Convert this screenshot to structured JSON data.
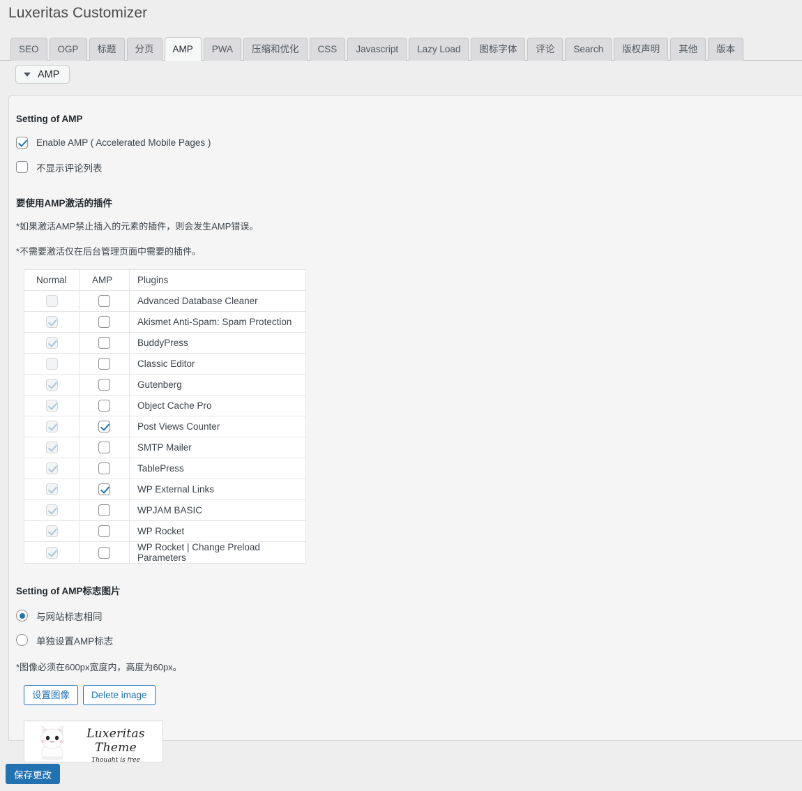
{
  "page": {
    "title": "Luxeritas Customizer",
    "accent_color": "#2271b1",
    "panel_bg": "#f5f5f5",
    "page_bg": "#eeeeee"
  },
  "tabs": [
    {
      "label": "SEO",
      "active": false
    },
    {
      "label": "OGP",
      "active": false
    },
    {
      "label": "标题",
      "active": false
    },
    {
      "label": "分页",
      "active": false
    },
    {
      "label": "AMP",
      "active": true
    },
    {
      "label": "PWA",
      "active": false
    },
    {
      "label": "压缩和优化",
      "active": false
    },
    {
      "label": "CSS",
      "active": false
    },
    {
      "label": "Javascript",
      "active": false
    },
    {
      "label": "Lazy Load",
      "active": false
    },
    {
      "label": "图标字体",
      "active": false
    },
    {
      "label": "评论",
      "active": false
    },
    {
      "label": "Search",
      "active": false
    },
    {
      "label": "版权声明",
      "active": false
    },
    {
      "label": "其他",
      "active": false
    },
    {
      "label": "版本",
      "active": false
    }
  ],
  "accordion": {
    "label": "AMP",
    "icon": "chevron-down-icon",
    "expanded": true
  },
  "amp_settings": {
    "heading": "Setting of AMP",
    "options": [
      {
        "label": "Enable AMP ( Accelerated Mobile Pages )",
        "checked": true
      },
      {
        "label": "不显示评论列表",
        "checked": false
      }
    ]
  },
  "plugins_section": {
    "heading": "要使用AMP激活的插件",
    "notes": [
      "*如果激活AMP禁止插入的元素的插件，则会发生AMP错误。",
      "*不需要激活仅在后台管理页面中需要的插件。"
    ],
    "columns": [
      "Normal",
      "AMP",
      "Plugins"
    ],
    "rows": [
      {
        "normal": false,
        "amp": false,
        "name": "Advanced Database Cleaner"
      },
      {
        "normal": true,
        "amp": false,
        "name": "Akismet Anti-Spam: Spam Protection"
      },
      {
        "normal": true,
        "amp": false,
        "name": "BuddyPress"
      },
      {
        "normal": false,
        "amp": false,
        "name": "Classic Editor"
      },
      {
        "normal": true,
        "amp": false,
        "name": "Gutenberg"
      },
      {
        "normal": true,
        "amp": false,
        "name": "Object Cache Pro"
      },
      {
        "normal": true,
        "amp": true,
        "name": "Post Views Counter"
      },
      {
        "normal": true,
        "amp": false,
        "name": "SMTP Mailer"
      },
      {
        "normal": true,
        "amp": false,
        "name": "TablePress"
      },
      {
        "normal": true,
        "amp": true,
        "name": "WP External Links"
      },
      {
        "normal": true,
        "amp": false,
        "name": "WPJAM BASIC"
      },
      {
        "normal": true,
        "amp": false,
        "name": "WP Rocket"
      },
      {
        "normal": true,
        "amp": false,
        "name": "WP Rocket | Change Preload Parameters"
      }
    ]
  },
  "logo_section": {
    "heading": "Setting of AMP标志图片",
    "radios": [
      {
        "label": "与网站标志相同",
        "checked": true
      },
      {
        "label": "单独设置AMP标志",
        "checked": false
      }
    ],
    "note": "*图像必须在600px宽度内，高度为60px。",
    "set_image_label": "设置图像",
    "delete_image_label": "Delete image",
    "preview": {
      "title": "Luxeritas Theme",
      "tagline": "Thought is free",
      "mascot": "white-cat-mascot"
    }
  },
  "footer": {
    "save_label": "保存更改"
  }
}
